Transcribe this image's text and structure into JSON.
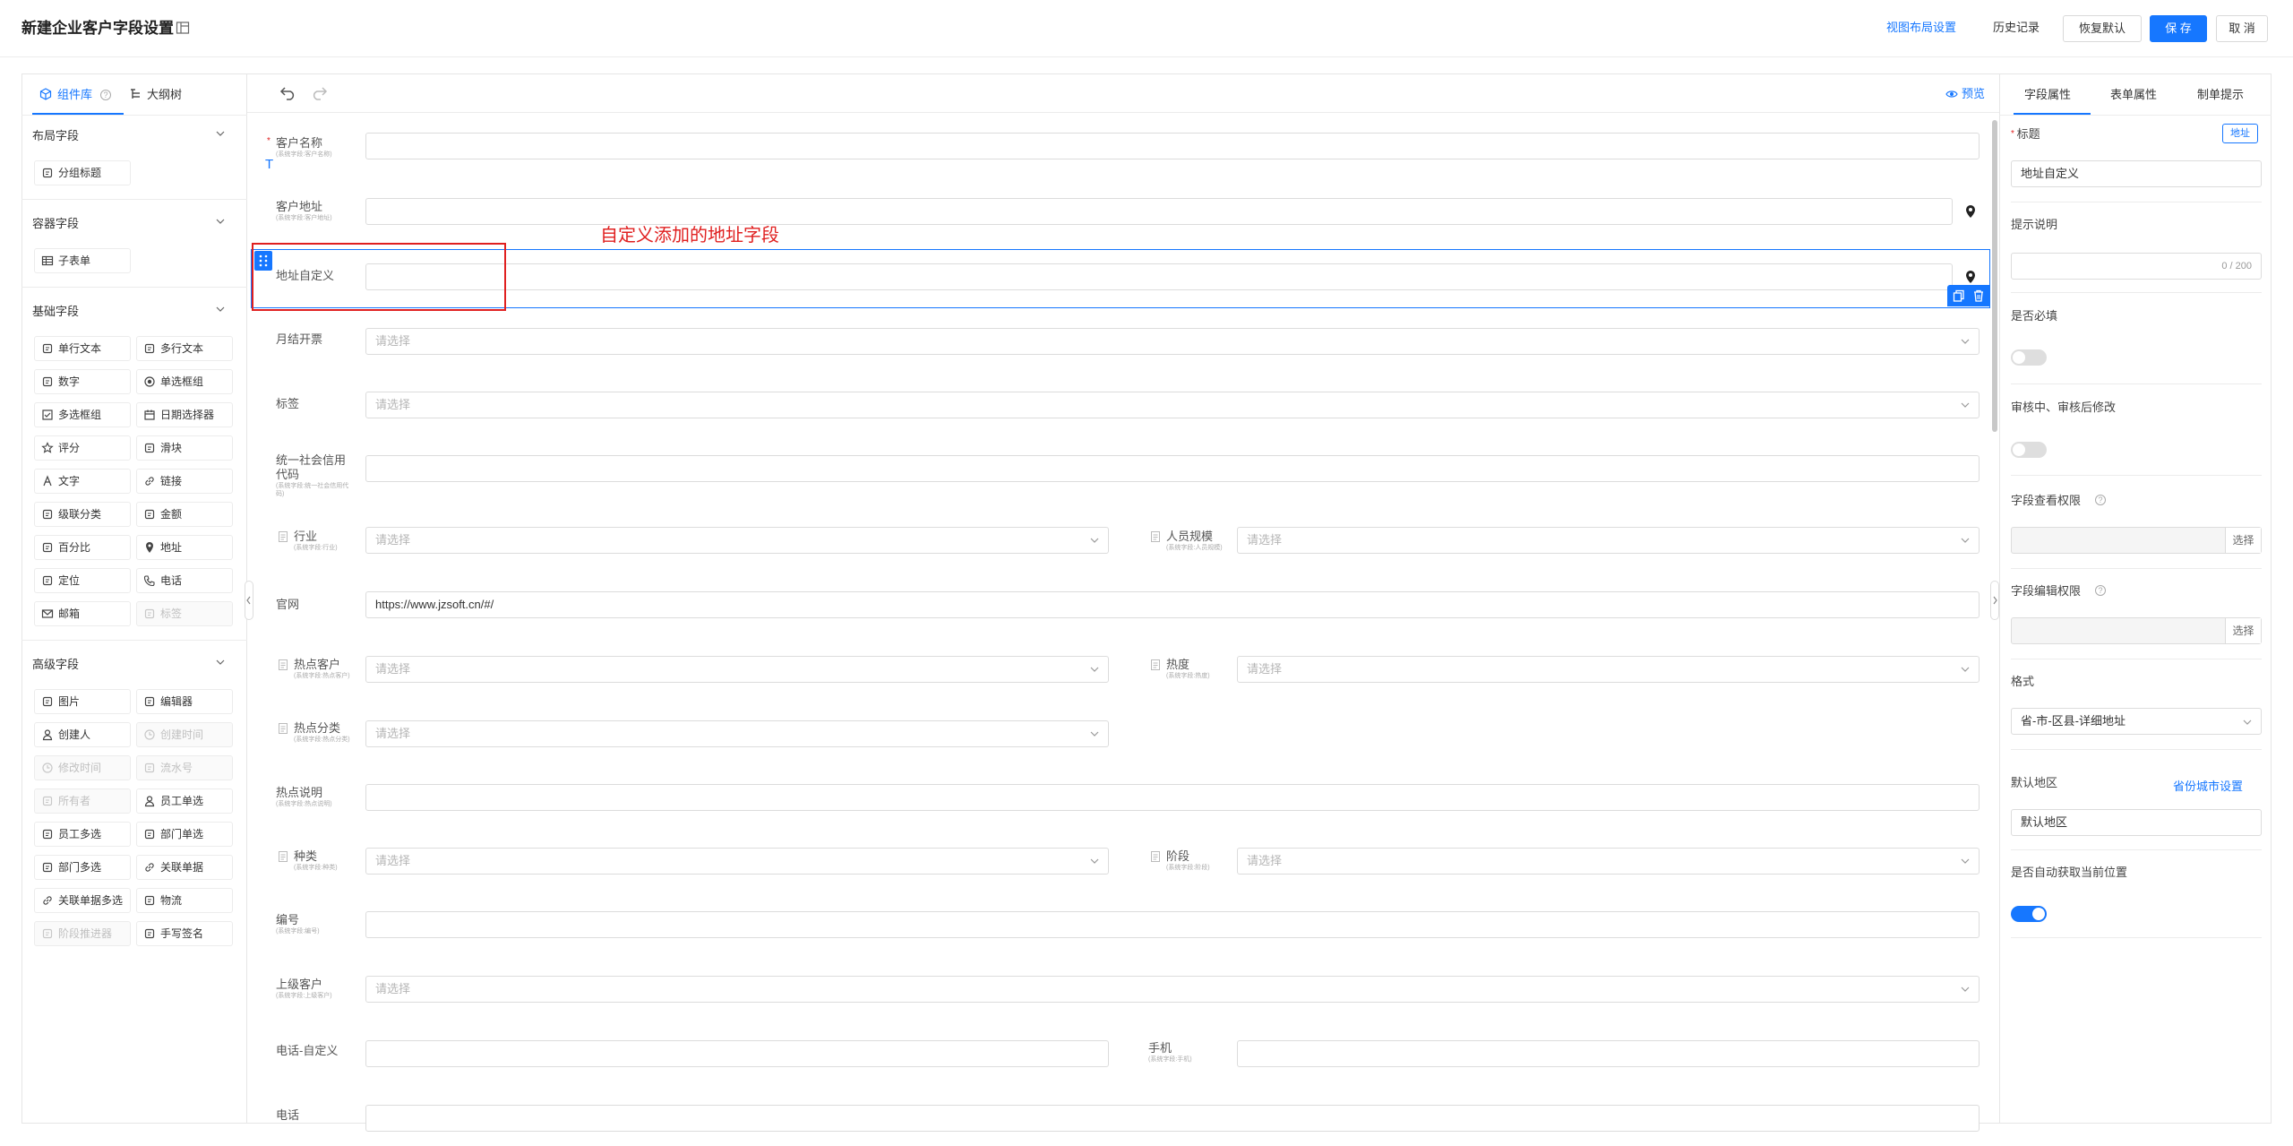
{
  "header": {
    "title": "新建企业客户字段设置",
    "view_layout": "视图布局设置",
    "history": "历史记录",
    "restore": "恢复默认",
    "save": "保 存",
    "cancel": "取 消"
  },
  "left_panel": {
    "tabs": [
      "组件库",
      "大纲树"
    ],
    "sections": [
      {
        "title": "布局字段",
        "items": [
          {
            "label": "分组标题",
            "icon": "group-title-icon",
            "disabled": false
          }
        ]
      },
      {
        "title": "容器字段",
        "items": [
          {
            "label": "子表单",
            "icon": "table-icon",
            "disabled": false
          }
        ]
      },
      {
        "title": "基础字段",
        "items": [
          {
            "label": "单行文本",
            "icon": "single-line-icon",
            "disabled": false
          },
          {
            "label": "多行文本",
            "icon": "multi-line-icon",
            "disabled": false
          },
          {
            "label": "数字",
            "icon": "number-icon",
            "disabled": false
          },
          {
            "label": "单选框组",
            "icon": "radio-icon",
            "disabled": false
          },
          {
            "label": "多选框组",
            "icon": "checkbox-icon",
            "disabled": false
          },
          {
            "label": "日期选择器",
            "icon": "calendar-icon",
            "disabled": false
          },
          {
            "label": "评分",
            "icon": "star-icon",
            "disabled": false
          },
          {
            "label": "滑块",
            "icon": "slider-icon",
            "disabled": false
          },
          {
            "label": "文字",
            "icon": "text-icon",
            "disabled": false
          },
          {
            "label": "链接",
            "icon": "link-icon",
            "disabled": false
          },
          {
            "label": "级联分类",
            "icon": "cascade-icon",
            "disabled": false
          },
          {
            "label": "金额",
            "icon": "money-icon",
            "disabled": false
          },
          {
            "label": "百分比",
            "icon": "percent-icon",
            "disabled": false
          },
          {
            "label": "地址",
            "icon": "location-pin-icon",
            "disabled": false
          },
          {
            "label": "定位",
            "icon": "position-icon",
            "disabled": false
          },
          {
            "label": "电话",
            "icon": "phone-icon",
            "disabled": false
          },
          {
            "label": "邮箱",
            "icon": "mail-icon",
            "disabled": false
          },
          {
            "label": "标签",
            "icon": "tag-icon",
            "disabled": true
          }
        ]
      },
      {
        "title": "高级字段",
        "items": [
          {
            "label": "图片",
            "icon": "image-icon",
            "disabled": false
          },
          {
            "label": "编辑器",
            "icon": "editor-icon",
            "disabled": false
          },
          {
            "label": "创建人",
            "icon": "user-icon",
            "disabled": false
          },
          {
            "label": "创建时间",
            "icon": "clock-icon",
            "disabled": true
          },
          {
            "label": "修改时间",
            "icon": "clock-icon",
            "disabled": true
          },
          {
            "label": "流水号",
            "icon": "serial-icon",
            "disabled": true
          },
          {
            "label": "所有者",
            "icon": "owner-icon",
            "disabled": true
          },
          {
            "label": "员工单选",
            "icon": "user-icon",
            "disabled": false
          },
          {
            "label": "员工多选",
            "icon": "users-icon",
            "disabled": false
          },
          {
            "label": "部门单选",
            "icon": "dept-icon",
            "disabled": false
          },
          {
            "label": "部门多选",
            "icon": "dept-icon",
            "disabled": false
          },
          {
            "label": "关联单据",
            "icon": "link-icon",
            "disabled": false
          },
          {
            "label": "关联单据多选",
            "icon": "link-icon",
            "disabled": false
          },
          {
            "label": "物流",
            "icon": "truck-icon",
            "disabled": false
          },
          {
            "label": "阶段推进器",
            "icon": "stage-icon",
            "disabled": true
          },
          {
            "label": "手写签名",
            "icon": "signature-icon",
            "disabled": false
          }
        ]
      }
    ]
  },
  "canvas": {
    "preview": "预览",
    "annotation": "自定义添加的地址字段",
    "fields": {
      "customer_name": {
        "label": "客户名称",
        "sub": "(系统字段:客户名称)"
      },
      "customer_addr": {
        "label": "客户地址",
        "sub": "(系统字段:客户地址)"
      },
      "custom_addr": {
        "label": "地址自定义"
      },
      "monthly_invoice": {
        "label": "月结开票",
        "placeholder": "请选择"
      },
      "tags": {
        "label": "标签",
        "placeholder": "请选择"
      },
      "credit_code": {
        "label": "统一社会信用代码",
        "sub": "(系统字段:统一社会信用代码)"
      },
      "industry": {
        "label": "行业",
        "sub": "(系统字段:行业)",
        "placeholder": "请选择"
      },
      "staff_size": {
        "label": "人员规模",
        "sub": "(系统字段:人员规模)",
        "placeholder": "请选择"
      },
      "website": {
        "label": "官网",
        "value": "https://www.jzsoft.cn/#/"
      },
      "hot_customer": {
        "label": "热点客户",
        "sub": "(系统字段:热点客户)",
        "placeholder": "请选择"
      },
      "heat": {
        "label": "热度",
        "sub": "(系统字段:热度)",
        "placeholder": "请选择"
      },
      "hot_category": {
        "label": "热点分类",
        "sub": "(系统字段:热点分类)",
        "placeholder": "请选择"
      },
      "hot_desc": {
        "label": "热点说明",
        "sub": "(系统字段:热点说明)"
      },
      "kind": {
        "label": "种类",
        "sub": "(系统字段:种类)",
        "placeholder": "请选择"
      },
      "stage": {
        "label": "阶段",
        "sub": "(系统字段:阶段)",
        "placeholder": "请选择"
      },
      "code": {
        "label": "编号",
        "sub": "(系统字段:编号)"
      },
      "parent_customer": {
        "label": "上级客户",
        "sub": "(系统字段:上级客户)",
        "placeholder": "请选择"
      },
      "phone_custom": {
        "label": "电话-自定义"
      },
      "mobile": {
        "label": "手机",
        "sub": "(系统字段:手机)"
      },
      "phone": {
        "label": "电话"
      }
    }
  },
  "right_panel": {
    "tabs": [
      "字段属性",
      "表单属性",
      "制单提示"
    ],
    "title_label": "标题",
    "type_badge": "地址",
    "title_value": "地址自定义",
    "hint_label": "提示说明",
    "hint_count": "0 / 200",
    "required_label": "是否必填",
    "editable_label": "审核中、审核后修改",
    "view_perm_label": "字段查看权限",
    "edit_perm_label": "字段编辑权限",
    "select_btn": "选择",
    "format_label": "格式",
    "format_value": "省-市-区县-详细地址",
    "default_region_label": "默认地区",
    "city_settings": "省份城市设置",
    "default_region_value": "默认地区",
    "auto_locate_label": "是否自动获取当前位置",
    "toggles": {
      "required": false,
      "editable": false,
      "auto_locate": true
    }
  }
}
